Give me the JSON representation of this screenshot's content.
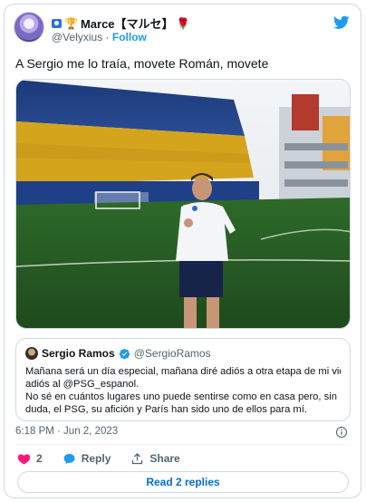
{
  "author": {
    "display_name": "Marce【マルセ】",
    "handle": "@Velyxius",
    "separator": "·",
    "follow_label": "Follow",
    "icons": [
      "verified-box-icon",
      "trophy-icon",
      "rose-icon"
    ]
  },
  "platform_icon": "twitter-bird-icon",
  "tweet_text": "A Sergio me lo traía, movete Román, movete",
  "photo": {
    "icon": "stadium-photo"
  },
  "quoted": {
    "name": "Sergio Ramos",
    "handle": "@SergioRamos",
    "lines": [
      "Mañana será un día especial, mañana diré adiós a otra etapa de mi vida,",
      "adiós al @PSG_espanol.",
      "No sé en cuántos lugares uno puede sentirse como en casa pero, sin",
      "duda, el PSG, su afición y París han sido uno de ellos para mí."
    ]
  },
  "timestamp": "6:18 PM · Jun 2, 2023",
  "actions": {
    "like_count": "2",
    "reply_label": "Reply",
    "share_label": "Share"
  },
  "read_replies_label": "Read 2 replies",
  "colors": {
    "accent": "#1d9bf0",
    "like": "#f91880",
    "link": "#006fd6",
    "muted": "#536471"
  }
}
